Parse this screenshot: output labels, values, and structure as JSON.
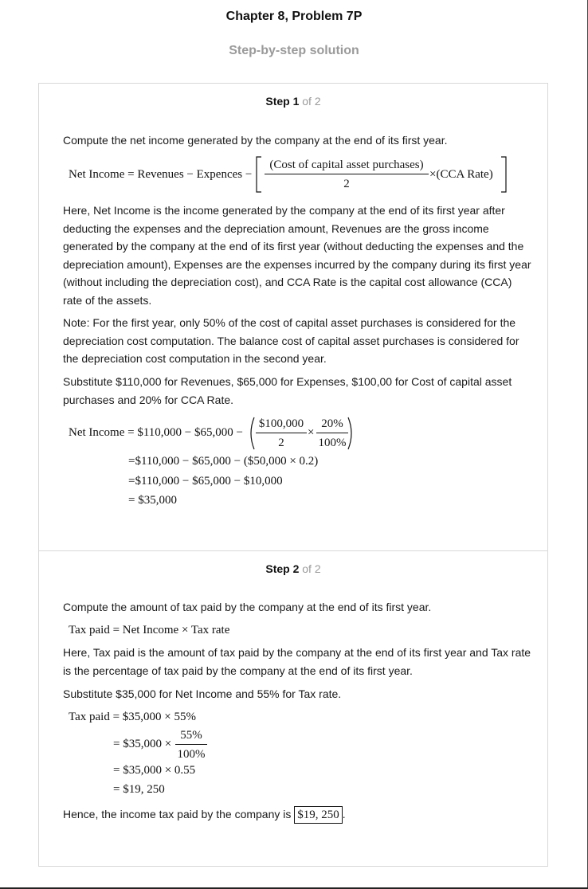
{
  "header": {
    "title": "Chapter 8, Problem 7P",
    "subtitle": "Step-by-step solution"
  },
  "step1": {
    "label": "Step 1",
    "of": " of 2",
    "intro": "Compute the net income generated by the company at the end of its first year.",
    "formula": {
      "lhs": "Net Income = Revenues − Expences −",
      "frac_num": "(Cost of capital asset purchases)",
      "frac_den": "2",
      "times_rate": "×(CCA Rate)"
    },
    "explanation": "Here, Net Income is the income generated by the company at the end of its first year after deducting the expenses and the depreciation amount, Revenues are the gross income generated by the company at the end of its first year (without deducting the expenses and the depreciation amount), Expenses are the expenses incurred by the company during its first year (without including the depreciation cost), and CCA Rate is the capital cost allowance (CCA) rate of the assets.",
    "note": "Note: For the first year, only 50% of the cost of capital asset purchases is considered for the depreciation cost computation. The balance cost of capital asset purchases is considered for the depreciation cost computation in the second year.",
    "substitute": "Substitute $110,000 for Revenues, $65,000 for Expenses, $100,00 for Cost of capital asset purchases and 20% for CCA Rate.",
    "calc": {
      "line1_lhs": "Net Income = $110,000 − $65,000 −",
      "line1_frac1_num": "$100,000",
      "line1_frac1_den": "2",
      "line1_times": "×",
      "line1_frac2_num": "20%",
      "line1_frac2_den": "100%",
      "line2": "=$110,000 − $65,000 − ($50,000 × 0.2)",
      "line3": "=$110,000 − $65,000 − $10,000",
      "line4": "= $35,000"
    }
  },
  "step2": {
    "label": "Step 2",
    "of": " of 2",
    "intro": "Compute the amount of tax paid by the company at the end of its first year.",
    "formula": "Tax paid = Net Income × Tax rate",
    "explanation": "Here, Tax paid is the amount of tax paid by the company at the end of its first year and Tax rate is the percentage of tax paid by the company at the end of its first year.",
    "substitute": "Substitute $35,000 for Net Income and 55% for Tax rate.",
    "calc": {
      "line1": "Tax paid = $35,000 × 55%",
      "line2_lhs": "= $35,000 ×",
      "line2_num": "55%",
      "line2_den": "100%",
      "line3": "= $35,000 × 0.55",
      "line4": "= $19, 250"
    },
    "conclusion": "Hence, the income tax paid by the company is",
    "answer": "$19, 250",
    "period": "."
  }
}
